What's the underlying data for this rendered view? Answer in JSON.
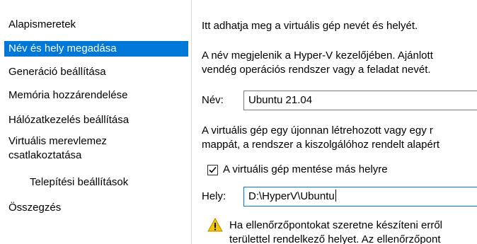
{
  "sidebar": {
    "items": [
      {
        "label": "Alapismeretek"
      },
      {
        "label": "Név és hely megadása",
        "selected": true
      },
      {
        "label": "Generáció beállítása"
      },
      {
        "label": "Memória hozzárendelése"
      },
      {
        "label": "Hálózatkezelés beállítása"
      },
      {
        "label": "Virtuális merevlemez",
        "label2": "csatlakoztatása"
      },
      {
        "label": "Telepítési beállítások"
      },
      {
        "label": "Összegzés"
      }
    ]
  },
  "main": {
    "intro": "Itt adhatja meg a virtuális gép nevét és helyét.",
    "description_line1": "A név megjelenik a Hyper-V kezelőjében. Ajánlott",
    "description_line2": "vendég operációs rendszer vagy a feladat nevét.",
    "name_label": "Név:",
    "name_value": "Ubuntu 21.04",
    "folder_text_line1": "A virtuális gép egy újonnan létrehozott vagy egy r",
    "folder_text_line2": "mappát, a rendszer a kiszolgálóhoz rendelt alapért",
    "store_checkbox_label": "A virtuális gép mentése más helyre",
    "store_checked": true,
    "location_label": "Hely:",
    "location_value": "D:\\HyperV\\Ubuntu",
    "warning_line1": "Ha ellenőrzőpontokat szeretne készíteni erről",
    "warning_line2": "területtel rendelkező helyet. Az ellenőrzőpont"
  },
  "colors": {
    "selection": "#0078d7",
    "divider": "#dcdcdc",
    "warning_icon": "#f2c500"
  },
  "icons": [
    "checkmark-icon",
    "warning-icon"
  ]
}
